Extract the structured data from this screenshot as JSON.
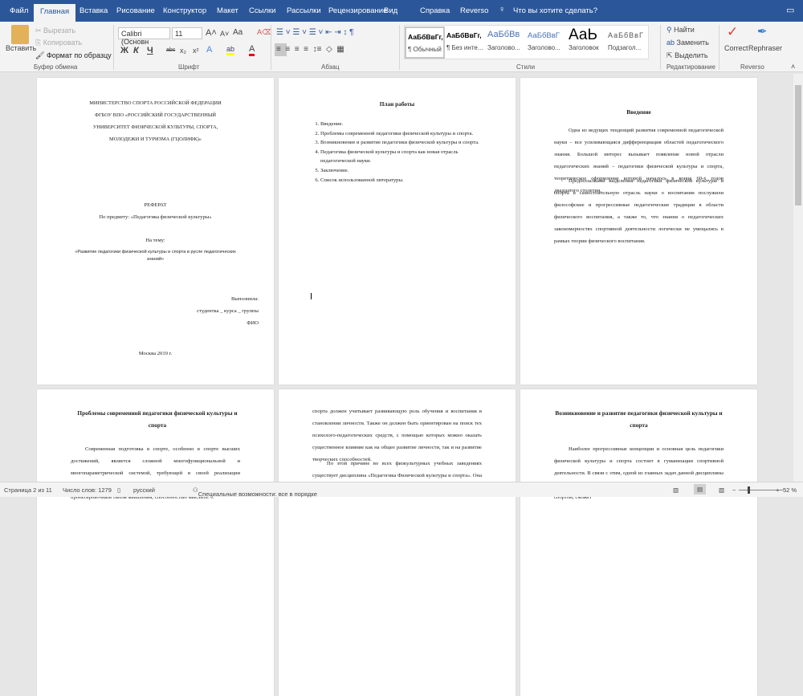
{
  "tabs": [
    "Файл",
    "Главная",
    "Вставка",
    "Рисование",
    "Конструктор",
    "Макет",
    "Ссылки",
    "Рассылки",
    "Рецензирование",
    "Вид",
    "Справка",
    "Reverso"
  ],
  "tell_me": "Что вы хотите сделать?",
  "clipboard": {
    "paste": "Вставить",
    "cut": "Вырезать",
    "copy": "Копировать",
    "format_painter": "Формат по образцу",
    "group": "Буфер обмена"
  },
  "font": {
    "name": "Calibri (Основн",
    "size": "11",
    "bold": "Ж",
    "italic": "К",
    "underline": "Ч",
    "strike": "abc",
    "sub": "x₂",
    "sup": "x²",
    "case": "Aa",
    "group": "Шрифт"
  },
  "paragraph": {
    "group": "Абзац"
  },
  "styles": {
    "items": [
      {
        "sample": "АаБбВвГг,",
        "name": "¶ Обычный"
      },
      {
        "sample": "АаБбВвГг,",
        "name": "¶ Без инте..."
      },
      {
        "sample": "АаБбВв",
        "name": "Заголово..."
      },
      {
        "sample": "АаБбВвГ",
        "name": "Заголово..."
      },
      {
        "sample": "АаЬ",
        "name": "Заголовок"
      },
      {
        "sample": "АаБбВвГ",
        "name": "Подзагол..."
      }
    ],
    "group": "Стили"
  },
  "editing": {
    "find": "Найти",
    "replace": "Заменить",
    "select": "Выделить",
    "group": "Редактирование"
  },
  "reverso": {
    "correct": "Correct",
    "rephraser": "Rephraser",
    "group": "Reverso"
  },
  "pages": {
    "title": {
      "lines": [
        "МИНИСТЕРСТВО СПОРТА РОССИЙСКОЙ ФЕДЕРАЦИИ",
        "ФГБОУ ВПО «РОССИЙСКИЙ ГОСУДАРСТВЕННЫЙ",
        "УНИВЕРСИТЕТ ФИЗИЧЕСКОЙ КУЛЬТУРЫ, СПОРТА,",
        "МОЛОДЕЖИ И ТУРИЗМА (ГЦОЛИФК)»"
      ],
      "type": "РЕФЕРАТ",
      "subject": "По предмету: «Педагогика физической культуры»",
      "theme_label": "На тему:",
      "theme": "«Развитие педагогики физической культуры и спорта в русле педагогических знаний»",
      "done_by": "Выполнила:",
      "student": "студентка _ курса _ группы",
      "fio": "ФИО",
      "city": "Москва 2019 г."
    },
    "plan": {
      "title": "План работы",
      "items": [
        "Введение.",
        "Проблемы современной педагогики физической культуры и спорта.",
        "Возникновение и развитие педагогики физической культуры и спорта.",
        "Педагогика физической культуры и спорта как новая отрасль педагогической науки.",
        "Заключение.",
        "Список использованной литературы."
      ]
    },
    "intro": {
      "title": "Введение",
      "p1": "Одна из ведущих тенденций развития современной педагогической науки – все усиливающаяся дифференциация областей педагогического знания. Большой интерес вызывает появление новой отрасли педагогических знаний – педагогики физической культуры и спорта, теоретическое оформление которой началось в конце 60-х годов двадцатого столетия.",
      "p2": "Предпосылками выделения педагогики физической культуры и спорта в самостоятельную отрасль науки о воспитании послужили философские и прогрессивные педагогические традиции в области физического воспитания, а также то, что знания о педагогических закономерностях спортивной деятельности логически не умещались в рамках теории физического воспитания."
    },
    "problems": {
      "title": "Проблемы современной педагогики физической культуры и спорта",
      "p1": "Современная подготовка в спорте, особенно в спорте высших достижений, является сложной многофункциональной и многопараметрической системой, требующей в своей реализации подготовку специалистов, которые обладают специальным проектировочным типом мышления, способностью мыслить. С"
    },
    "cont": {
      "p1": "спорта должен учитывает развивающую роль обучения и воспитания в становлении личности. Также он должен быть ориентирован на поиск тех психолого-педагогических средств, с помощью которых можно оказать существенное влияние как на общее развитие личности, так и на развитие творческих способностей.",
      "p2": "По этой причине во всех физкультурных учебных заведениях существует дисциплина «Педагогика Физической культуры и спорта». Она является профилированной, общепрофессиональной, значимой в системе"
    },
    "origin": {
      "title": "Возникновение и развитие педагогики физической культуры и спорта",
      "p1": "Наиболее прогрессивные концепции и основная цель педагогики физической культуры и спорта состоит в гуманизации спортивной деятельности. В связи с этим, одной из главных задач данной дисциплины является, изучение условий, при которых каждый человек занимающийся спортом, сможет"
    }
  },
  "status": {
    "page": "Страница 2 из 11",
    "words": "Число слов: 1279",
    "lang": "русский",
    "accessibility": "Специальные возможности: все в порядке",
    "zoom": "52 %",
    "zoom_percent": 52
  },
  "colors": {
    "brand": "#2b579a"
  }
}
